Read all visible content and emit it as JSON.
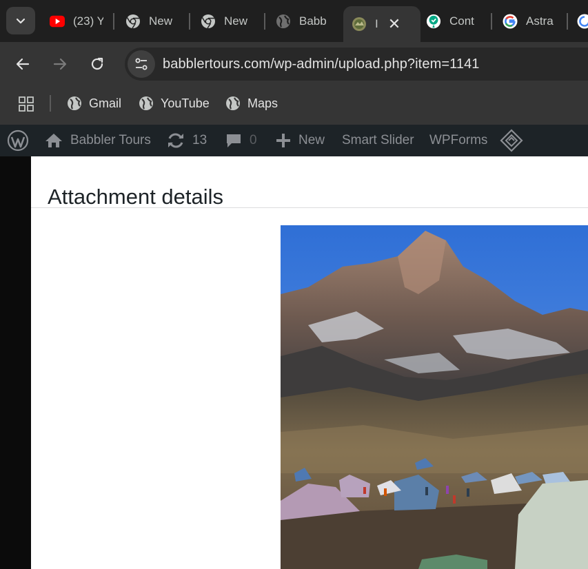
{
  "browser": {
    "tabs": [
      {
        "label": "(23) Y",
        "icon": "youtube-icon"
      },
      {
        "label": "New",
        "icon": "chrome-icon"
      },
      {
        "label": "New",
        "icon": "chrome-icon"
      },
      {
        "label": "Babb",
        "icon": "globe-icon"
      },
      {
        "label": "I",
        "icon": "site-favicon",
        "active": true
      },
      {
        "label": "Cont",
        "icon": "shield-check-icon"
      },
      {
        "label": "Astra",
        "icon": "google-icon"
      }
    ],
    "url": "babblertours.com/wp-admin/upload.php?item=1141",
    "bookmarks": [
      {
        "label": "Gmail",
        "icon": "globe-icon"
      },
      {
        "label": "YouTube",
        "icon": "globe-icon"
      },
      {
        "label": "Maps",
        "icon": "globe-icon"
      }
    ]
  },
  "adminbar": {
    "site_name": "Babbler Tours",
    "updates_count": "13",
    "comments_count": "0",
    "new_label": "New",
    "smart_slider_label": "Smart Slider",
    "wpforms_label": "WPForms"
  },
  "modal": {
    "title": "Attachment details"
  },
  "colors": {
    "adminbar_bg": "#1d2327",
    "browser_bg": "#1f1f1f",
    "toolbar_bg": "#353535",
    "youtube_red": "#ff0000"
  }
}
